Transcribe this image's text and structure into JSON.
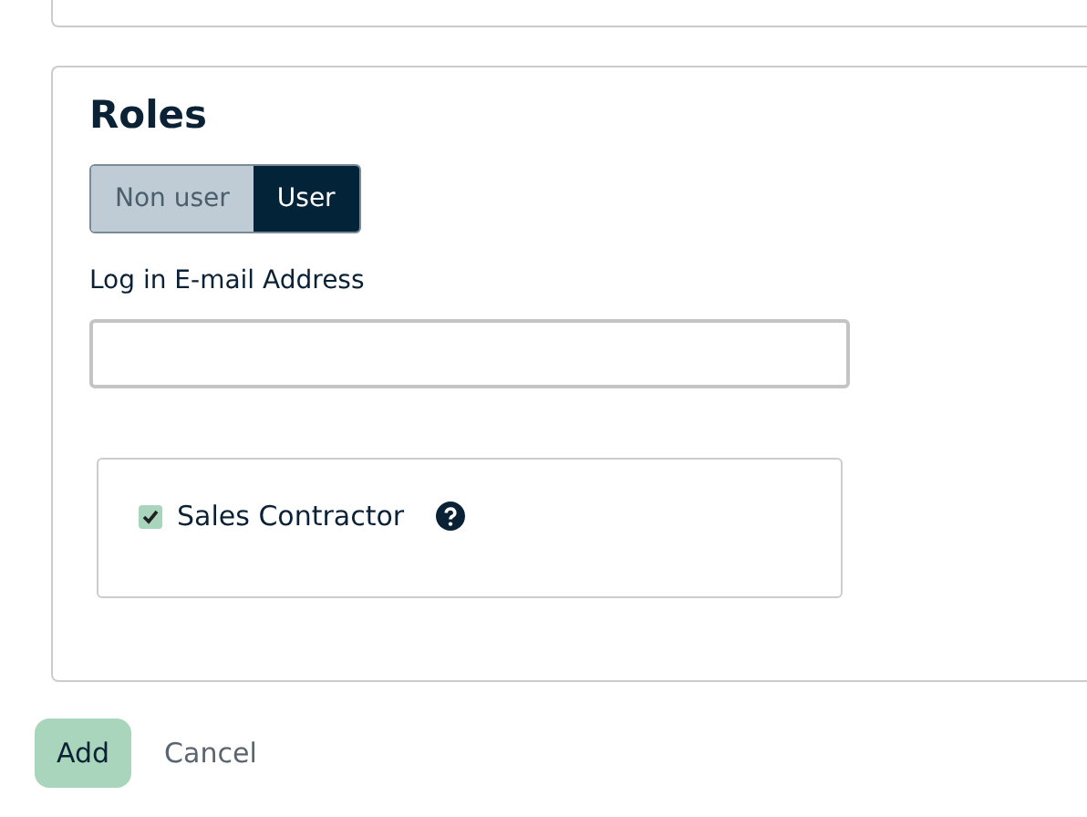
{
  "roles_card": {
    "title": "Roles",
    "toggle": [
      {
        "label": "Non user",
        "selected": false
      },
      {
        "label": "User",
        "selected": true
      }
    ],
    "email_field": {
      "label": "Log in E-mail Address"
    },
    "role_options": [
      {
        "label": "Sales Contractor",
        "checked": true
      }
    ]
  },
  "buttons": {
    "add": "Add",
    "cancel": "Cancel"
  }
}
